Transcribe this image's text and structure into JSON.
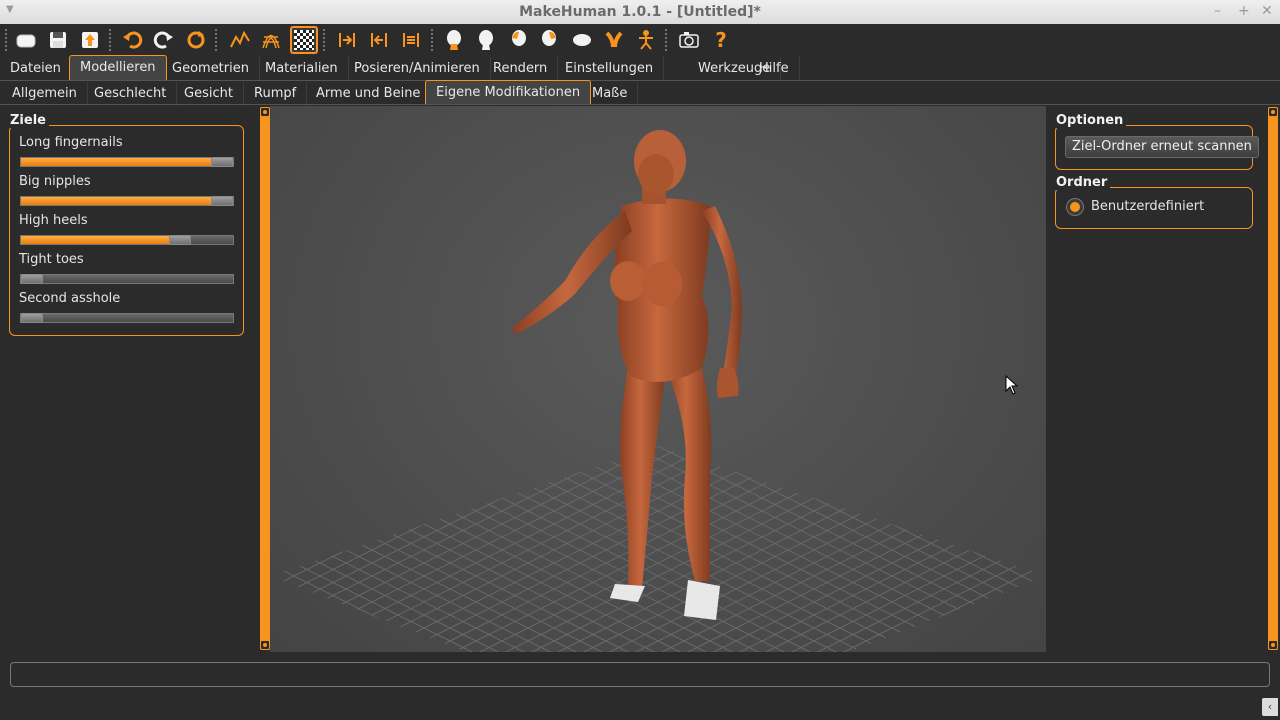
{
  "window": {
    "title": "MakeHuman 1.0.1 - [Untitled]*"
  },
  "toolbar": {
    "icons": [
      "new-icon",
      "save-icon",
      "export-icon",
      "undo-icon",
      "redo-icon",
      "reset-icon",
      "smooth-icon",
      "wireframe-icon",
      "background-icon",
      "front-view-icon",
      "back-view-icon",
      "left-view-icon",
      "right-view-icon",
      "top-view-icon",
      "bottom-view-icon",
      "reset-camera-icon",
      "pose-icon",
      "screenshot-icon",
      "help-icon"
    ]
  },
  "main_tabs": [
    "Dateien",
    "Modellieren",
    "Geometrien",
    "Materialien",
    "Posieren/Animieren",
    "Rendern",
    "Einstellungen",
    "Werkzeuge",
    "Hilfe"
  ],
  "sub_tabs": [
    "Allgemein",
    "Geschlecht",
    "Gesicht",
    "Rumpf",
    "Arme und Beine",
    "Eigene Modifikationen",
    "Maße"
  ],
  "left_panel": {
    "title": "Ziele",
    "sliders": [
      {
        "label": "Long fingernails",
        "value": 1.0
      },
      {
        "label": "Big nipples",
        "value": 1.0
      },
      {
        "label": "High heels",
        "value": 0.78
      },
      {
        "label": "Tight toes",
        "value": 0.0
      },
      {
        "label": "Second asshole",
        "value": 0.0
      }
    ]
  },
  "right_panel": {
    "options_title": "Optionen",
    "rescan_button": "Ziel-Ordner erneut scannen",
    "folder_title": "Ordner",
    "folder_option": "Benutzerdefiniert"
  },
  "colors": {
    "accent": "#f7941d",
    "background": "#2b2b2b",
    "viewport": "#4c4c4c",
    "skin": "#c0643c"
  }
}
